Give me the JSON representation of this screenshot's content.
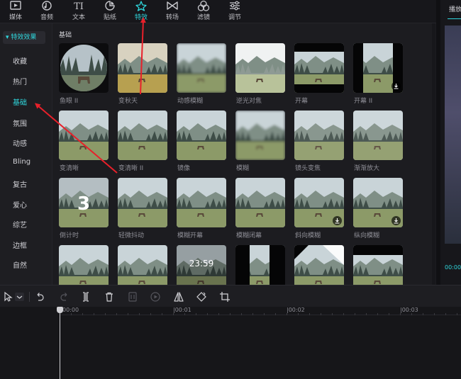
{
  "toolbar": {
    "tools": [
      {
        "label": "媒体",
        "icon": "media-icon"
      },
      {
        "label": "音频",
        "icon": "audio-icon"
      },
      {
        "label": "文本",
        "icon": "text-icon"
      },
      {
        "label": "贴纸",
        "icon": "sticker-icon"
      },
      {
        "label": "特效",
        "icon": "effects-icon",
        "active": true
      },
      {
        "label": "转场",
        "icon": "transition-icon"
      },
      {
        "label": "滤镜",
        "icon": "filter-icon"
      },
      {
        "label": "调节",
        "icon": "adjust-icon"
      }
    ],
    "text_glyph": "TI"
  },
  "preview": {
    "label": "播放",
    "time": "00:00"
  },
  "sidebar": {
    "header": "▾ 特效效果",
    "items": [
      {
        "label": "收藏"
      },
      {
        "label": "热门"
      },
      {
        "label": "基础",
        "active": true
      },
      {
        "label": "氛围"
      },
      {
        "label": "动感"
      },
      {
        "label": "Bling"
      },
      {
        "label": "复古"
      },
      {
        "label": "爱心"
      },
      {
        "label": "综艺"
      },
      {
        "label": "边框"
      },
      {
        "label": "自然"
      }
    ]
  },
  "main": {
    "section_title": "基础",
    "effects": [
      {
        "label": "鱼眼 II",
        "style": "fisheye"
      },
      {
        "label": "变秋天",
        "style": "autumn"
      },
      {
        "label": "动感模糊",
        "style": "blur"
      },
      {
        "label": "逆光对焦",
        "style": "bright"
      },
      {
        "label": "开幕",
        "style": "curtain"
      },
      {
        "label": "开幕 II",
        "style": "curtain2",
        "download": true
      },
      {
        "label": "变清晰",
        "style": "normal"
      },
      {
        "label": "变清晰 II",
        "style": "normal"
      },
      {
        "label": "镜像",
        "style": "normal"
      },
      {
        "label": "模糊",
        "style": "blur"
      },
      {
        "label": "镜头变焦",
        "style": "zoom"
      },
      {
        "label": "渐渐放大",
        "style": "zoom"
      },
      {
        "label": "倒计时",
        "style": "countdown",
        "overlay": "3"
      },
      {
        "label": "轻微抖动",
        "style": "normal"
      },
      {
        "label": "模糊开幕",
        "style": "normal"
      },
      {
        "label": "模糊闭幕",
        "style": "normal"
      },
      {
        "label": "斜向模糊",
        "style": "normal",
        "download": true
      },
      {
        "label": "纵向模糊",
        "style": "normal",
        "download": true
      },
      {
        "label": "",
        "style": "normal"
      },
      {
        "label": "",
        "style": "normal"
      },
      {
        "label": "",
        "style": "clock",
        "overlay": "23:59"
      },
      {
        "label": "",
        "style": "splitv"
      },
      {
        "label": "",
        "style": "diag"
      },
      {
        "label": "",
        "style": "splitbar"
      }
    ]
  },
  "timeline": {
    "ticks": [
      "00:00",
      "|00:01",
      "|00:02",
      "|00:03"
    ]
  },
  "colors": {
    "accent": "#2fd6dc",
    "arrow": "#e8202a"
  }
}
